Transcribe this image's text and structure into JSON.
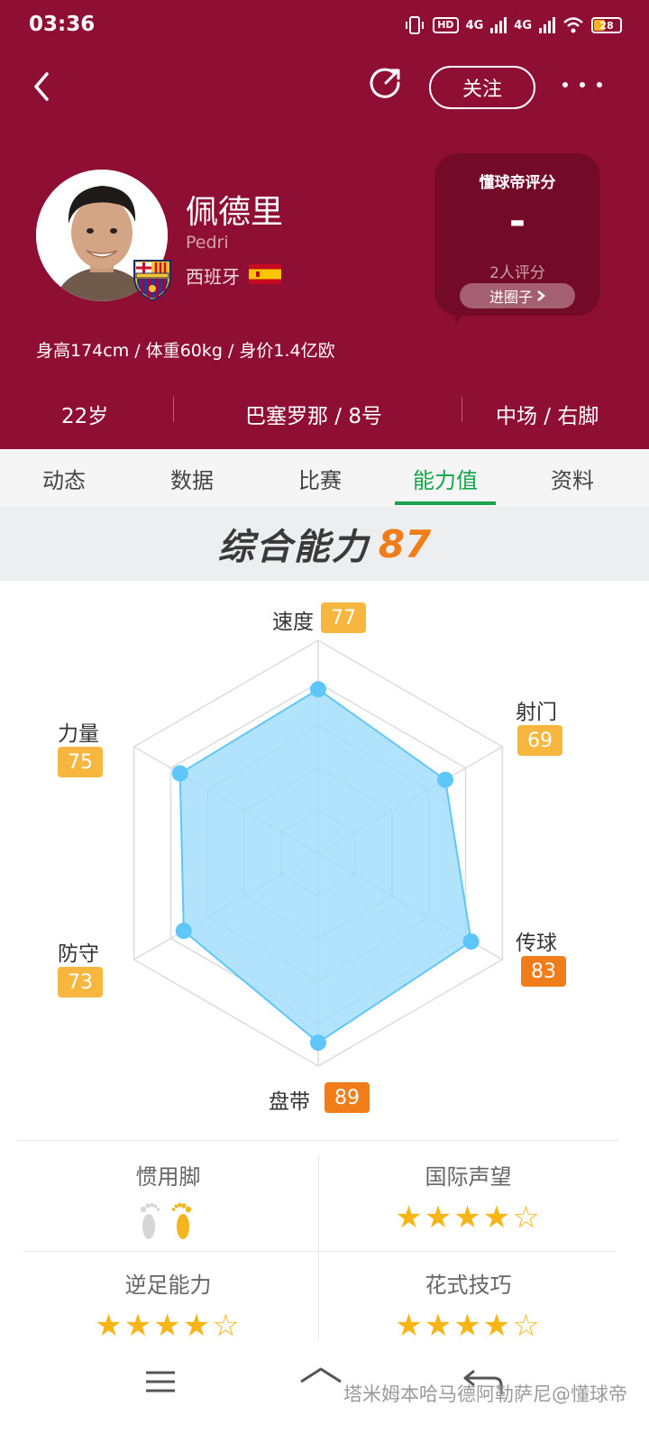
{
  "status_bar": {
    "time": "03:36",
    "hd": "HD",
    "network1": "4G",
    "network2": "4G",
    "battery": "28"
  },
  "nav": {
    "follow_label": "关注"
  },
  "player": {
    "name": "佩德里",
    "latin_name": "Pedri",
    "country": "西班牙",
    "bio": "身高174cm / 体重60kg / 身价1.4亿欧",
    "age": "22岁",
    "club_number": "巴塞罗那 / 8号",
    "position_foot": "中场 / 右脚"
  },
  "rating_card": {
    "title": "懂球帝评分",
    "value": "-",
    "count": "2人评分",
    "button": "进圈子"
  },
  "tabs": [
    {
      "label": "动态"
    },
    {
      "label": "数据"
    },
    {
      "label": "比赛"
    },
    {
      "label": "能力值",
      "active": true
    },
    {
      "label": "资料"
    }
  ],
  "overall": {
    "label": "综合能力",
    "value": "87"
  },
  "chart_data": {
    "type": "radar",
    "max": 100,
    "axes": [
      {
        "label": "速度",
        "value": 77
      },
      {
        "label": "射门",
        "value": 69
      },
      {
        "label": "传球",
        "value": 83
      },
      {
        "label": "盘带",
        "value": 89
      },
      {
        "label": "防守",
        "value": 73
      },
      {
        "label": "力量",
        "value": 75
      }
    ]
  },
  "traits": [
    {
      "title": "惯用脚",
      "type": "foot",
      "value": "右脚"
    },
    {
      "title": "国际声望",
      "type": "stars",
      "rating": 4,
      "max": 5
    },
    {
      "title": "逆足能力",
      "type": "stars",
      "rating": 4,
      "max": 5
    },
    {
      "title": "花式技巧",
      "type": "stars",
      "rating": 4,
      "max": 5
    }
  ],
  "watermark": "塔米姆本哈马德阿勒萨尼@懂球帝",
  "colors": {
    "header_bg": "#8e0e34",
    "accent_green": "#16a34a",
    "accent_orange": "#f07d1a",
    "badge_yellow": "#f7b73f",
    "badge_orange": "#f07d1a",
    "radar_fill": "#9fdcfb",
    "radar_point": "#5fc6fa",
    "star": "#f8b516"
  },
  "icons": {
    "back": "chevron-left-icon",
    "share": "share-icon",
    "more": "more-icon",
    "menu": "menu-icon",
    "home": "home-icon",
    "return": "return-icon"
  }
}
